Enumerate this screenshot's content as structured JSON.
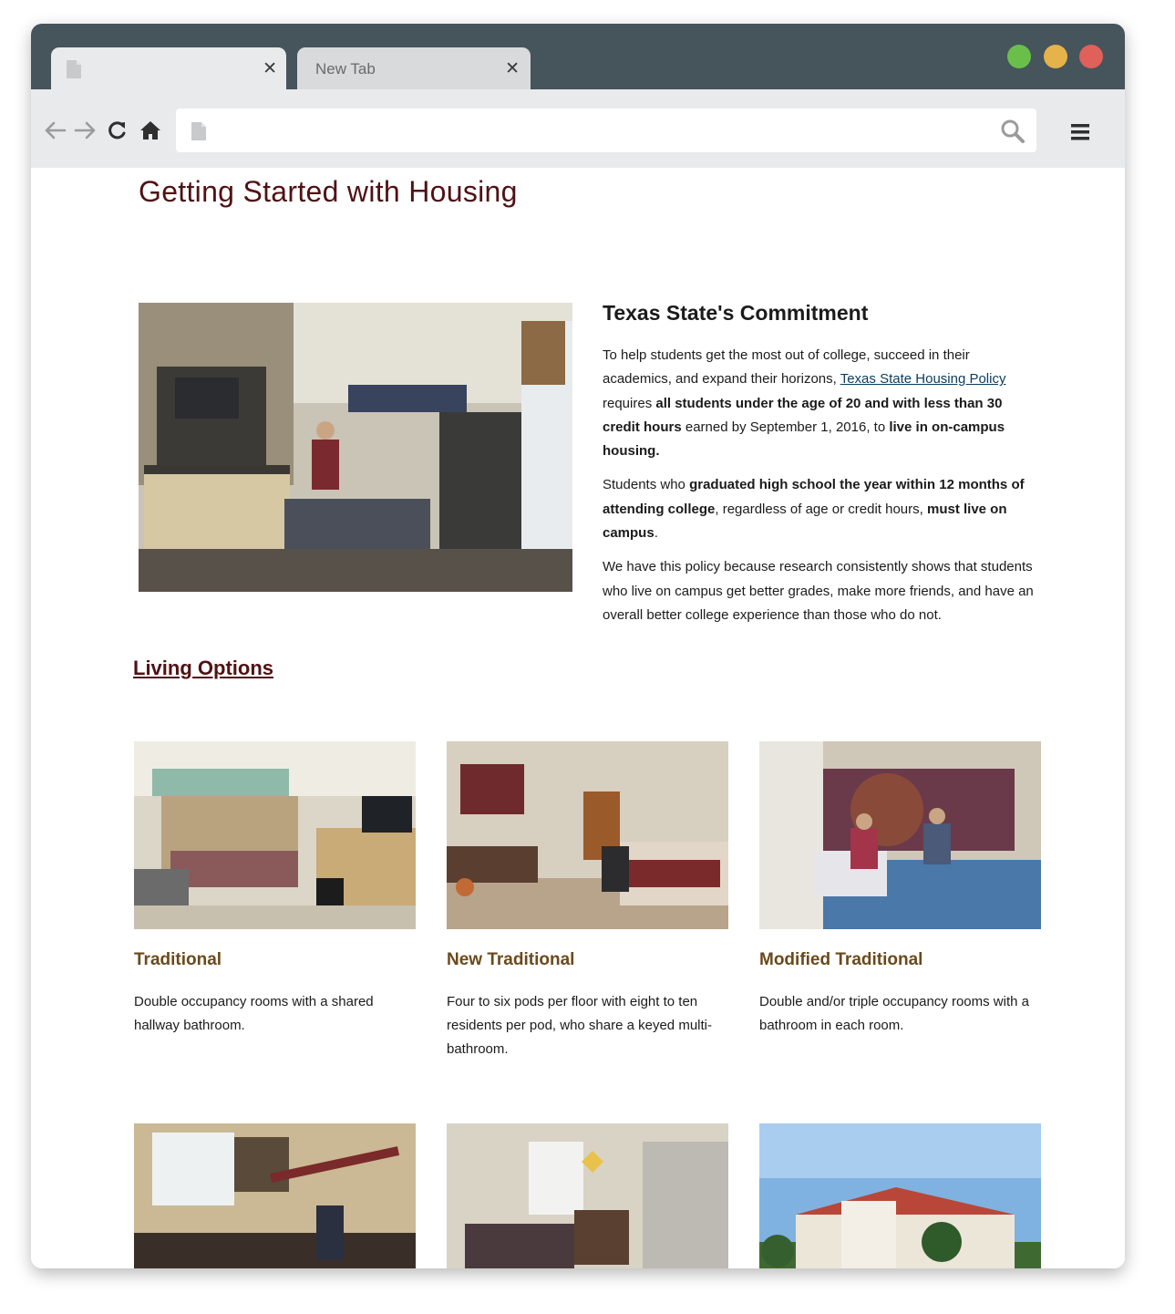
{
  "browser": {
    "tabs": [
      {
        "title": "",
        "close_glyph": "✕"
      },
      {
        "title": "New Tab",
        "close_glyph": "✕"
      }
    ],
    "window_controls": {
      "green": "#6abf4b",
      "yellow": "#e6b24a",
      "red": "#e0605a"
    },
    "address": "",
    "icons": [
      "back-arrow-icon",
      "forward-arrow-icon",
      "reload-icon",
      "home-icon",
      "page-icon",
      "search-icon",
      "hamburger-menu-icon"
    ]
  },
  "page": {
    "title": "Getting Started with Housing",
    "commitment": {
      "heading": "Texas State's Commitment",
      "p1": {
        "a": "To help students get the most out of college, succeed in their academics, and expand their horizons, ",
        "link": "Texas State Housing Policy",
        "b": " requires ",
        "bold1": "all students under the age of 20 and with less than 30 credit hours",
        "c": " earned by September 1, 2016, to ",
        "bold2": "live in on-campus housing."
      },
      "p2": {
        "a": "Students who ",
        "bold1": "graduated high school the year within 12 months of attending college",
        "b": ", regardless of age or credit hours, ",
        "bold2": "must live on campus",
        "c": "."
      },
      "p3": "We have this policy because research consistently shows that students who live on campus get better grades, make more friends, and have an overall better college experience than those who do not."
    },
    "living_options": {
      "heading": "Living Options",
      "cards": [
        {
          "title": "Traditional",
          "desc": "Double occupancy rooms with a shared hallway bathroom."
        },
        {
          "title": "New Traditional",
          "desc": "Four to six pods per floor with eight to ten residents per pod, who share a keyed multi-bathroom."
        },
        {
          "title": "Modified Traditional",
          "desc": "Double and/or triple occupancy rooms with a bathroom in each room."
        }
      ]
    }
  },
  "colors": {
    "maroon": "#501214",
    "gold_brown": "#6a4a1b",
    "link": "#0b3d5c",
    "chrome_dark": "#46545c",
    "chrome_light": "#e9eaeb"
  }
}
